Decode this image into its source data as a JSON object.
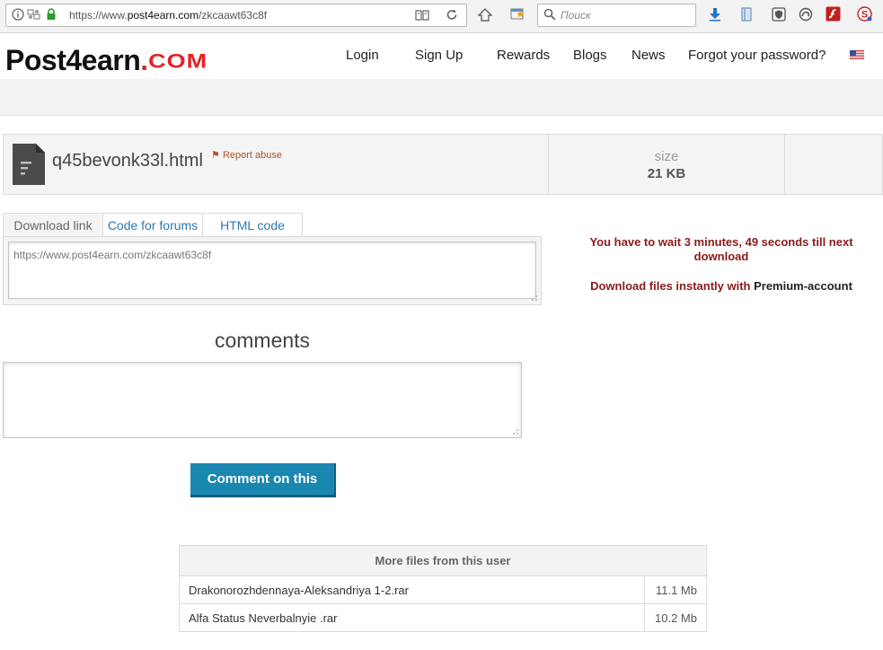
{
  "browser": {
    "url_prefix": "https://www.",
    "url_host": "post4earn.com",
    "url_path": "/zkcaawt63c8f",
    "search_placeholder": "Поиск",
    "icons": [
      "info-icon",
      "permissions-icon",
      "lock-icon",
      "reader-view-icon",
      "reload-icon",
      "home-icon",
      "bookmark-icon",
      "search-icon",
      "download-icon",
      "library-icon",
      "shield-icon",
      "sync-icon",
      "flash-icon",
      "addon-s-icon"
    ]
  },
  "header": {
    "logo_main": "Post4earn",
    "logo_dot": ".",
    "logo_tld": "COM",
    "nav": [
      "Login",
      "Sign Up",
      "Rewards",
      "Blogs",
      "News",
      "Forgot your password?"
    ],
    "language_flag": "us-flag-icon"
  },
  "file": {
    "name": "q45bevonk33l.html",
    "report_abuse": "Report abuse",
    "size_label": "size",
    "size_value": "21 KB"
  },
  "tabs": [
    "Download link",
    "Code for forums",
    "HTML code"
  ],
  "link_value": "https://www.post4earn.com/zkcaawt63c8f",
  "notice": {
    "wait": "You have to wait 3 minutes, 49 seconds till next download",
    "premium_prefix": "Download files instantly with ",
    "premium_link": "Premium-account"
  },
  "comments": {
    "title": "comments",
    "button": "Comment on this"
  },
  "more_files": {
    "header": "More files from this user",
    "rows": [
      {
        "name": "Drakonorozhdennaya-Aleksandriya 1-2.rar",
        "size": "11.1 Mb"
      },
      {
        "name": "Alfa Status Neverbalnyie .rar",
        "size": "10.2 Mb"
      }
    ]
  },
  "colors": {
    "logo_accent": "#e2222a",
    "link_blue": "#2a7ab3",
    "notice_red": "#8b1a1a",
    "button_blue": "#1a87b1"
  }
}
